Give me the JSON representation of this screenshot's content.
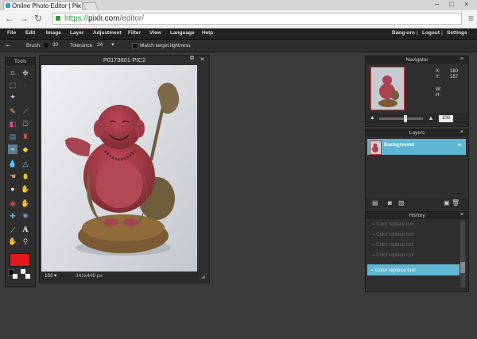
{
  "browser": {
    "tab_title": "Online Photo Editor | Pix",
    "url_scheme": "https://",
    "url_host": "pixlr.com",
    "url_path": "/editor/"
  },
  "menu": {
    "items": [
      "File",
      "Edit",
      "Image",
      "Layer",
      "Adjustment",
      "Filter",
      "View",
      "Language",
      "Help"
    ],
    "right": [
      "Bang-orn",
      "Logout",
      "Settings"
    ]
  },
  "options": {
    "brush_label": "Brush:",
    "brush_size": "30",
    "tolerance_label": "Tolerance:",
    "tolerance_value": "24",
    "match_label": "Match target lightness"
  },
  "tools": {
    "title": "Tools"
  },
  "canvas": {
    "title": "P0173601-PIC2",
    "zoom": "100",
    "dimensions": "341x449 px"
  },
  "navigator": {
    "title": "Navigator",
    "x_label": "X:",
    "x_value": "180",
    "y_label": "Y:",
    "y_value": "187",
    "w_label": "W:",
    "h_label": "H:",
    "zoom_value": "100",
    "zoom_fraction": 0.6
  },
  "layers": {
    "title": "Layers",
    "items": [
      {
        "name": "Background"
      }
    ]
  },
  "history": {
    "title": "History",
    "items": [
      "Color replace tool",
      "Color replace tool",
      "Color replace tool",
      "Color replace tool",
      "Color replace tool"
    ],
    "active": "Color replace tool"
  },
  "colors": {
    "primary": "#e31a1a",
    "accent": "#5fb6d2",
    "background": "#3b3b3b"
  }
}
